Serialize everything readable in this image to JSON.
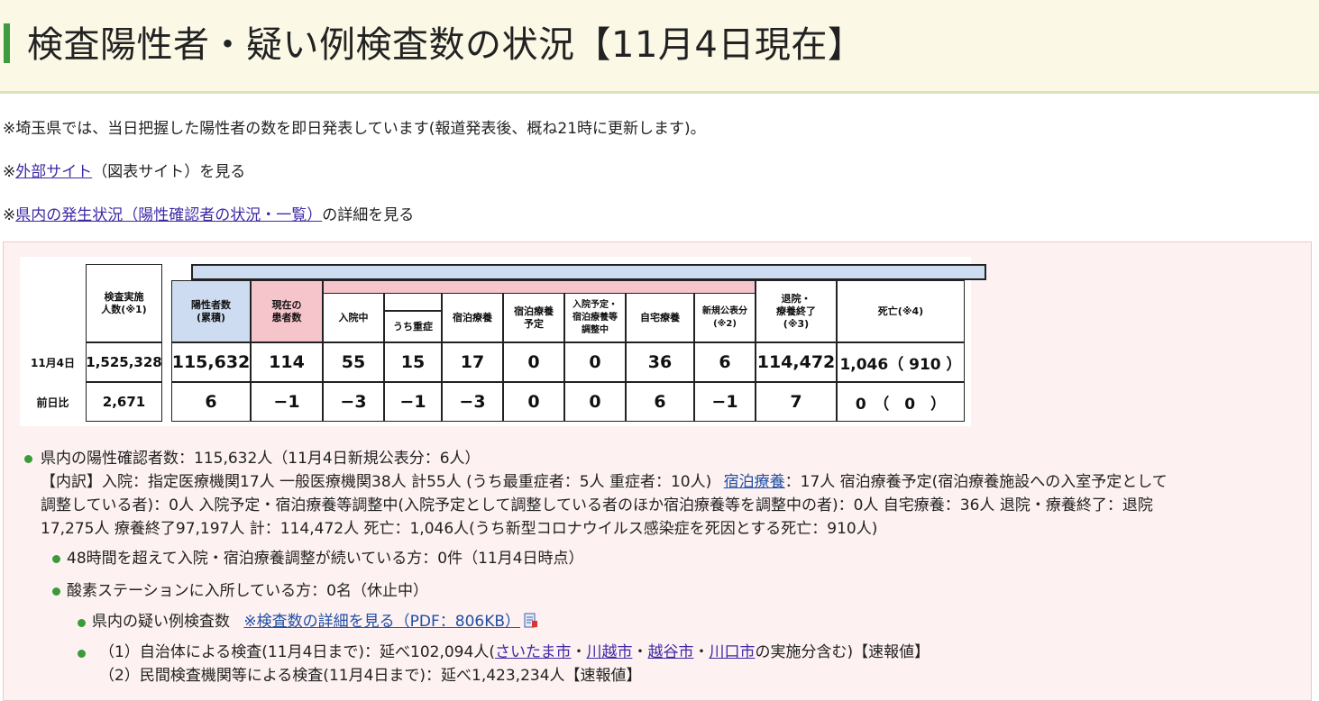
{
  "title": "検査陽性者・疑い例検査数の状況【11月4日現在】",
  "intro": {
    "line1": "※埼玉県では、当日把握した陽性者の数を即日発表しています(報道発表後、概ね21時に更新します)。",
    "line2_prefix": "※",
    "line2_link": "外部サイト",
    "line2_suffix": "（図表サイト）を見る",
    "line3_prefix": "※",
    "line3_link": "県内の発生状況（陽性確認者の状況・一覧）",
    "line3_suffix": "の詳細を見る"
  },
  "table": {
    "headers": {
      "tests": "検査実施\n人数(※1)",
      "positives": "陽性者数\n(累積)",
      "current": "現在の\n患者数",
      "hospitalized": "入院中",
      "severe": "うち重症",
      "hotel": "宿泊療養",
      "hotel_planned": "宿泊療養\n予定",
      "adjusting": "入院予定・\n宿泊療養等\n調整中",
      "home": "自宅療養",
      "new_published": "新規公表分\n(※2)",
      "recovered": "退院・\n療養終了\n(※3)",
      "deaths": "死亡(※4)"
    },
    "rows": [
      {
        "label": "11月4日",
        "tests": "1,525,328",
        "positives": "115,632",
        "current": "114",
        "hospitalized": "55",
        "severe": "15",
        "hotel": "17",
        "hotel_planned": "0",
        "adjusting": "0",
        "home": "36",
        "new_published": "6",
        "recovered": "114,472",
        "deaths": "1,046（ 910 ）"
      },
      {
        "label": "前日比",
        "tests": "2,671",
        "positives": "6",
        "current": "−1",
        "hospitalized": "−3",
        "severe": "−1",
        "hotel": "−3",
        "hotel_planned": "0",
        "adjusting": "0",
        "home": "6",
        "new_published": "−1",
        "recovered": "7",
        "deaths": "0　（　0　）"
      }
    ]
  },
  "details": {
    "summary": "県内の陽性確認者数：115,632人（11月4日新規公表分：6人）",
    "breakdown_1a": "【内訳】入院：指定医療機関17人 一般医療機関38人 計55人 (うち最重症者：5人 重症者：10人)",
    "breakdown_1_link": "宿泊療養",
    "breakdown_1b": "：17人 宿泊療養予定(宿泊療養施設への入室予定として",
    "breakdown_2": "調整している者)：0人 入院予定・宿泊療養等調整中(入院予定として調整している者のほか宿泊療養等を調整中の者)：0人 自宅療養：36人 退院・療養終了：退院",
    "breakdown_3": "17,275人 療養終了97,197人 計：114,472人 死亡：1,046人(うち新型コロナウイルス感染症を死因とする死亡：910人)",
    "waiting": "48時間を超えて入院・宿泊療養調整が続いている方：0件（11月4日時点）",
    "oxygen": "酸素ステーションに入所している方：0名（休止中）",
    "suspected_label": "県内の疑い例検査数",
    "suspected_link": "※検査数の詳細を見る（PDF：806KB）",
    "local_prefix": "（1）自治体による検査(11月4日まで)：延べ102,094人(",
    "city1": "さいたま市",
    "city2": "川越市",
    "city3": "越谷市",
    "city4": "川口市",
    "sep": "・",
    "local_suffix": "の実施分含む)【速報値】",
    "private": "（2）民間検査機関等による検査(11月4日まで)：延べ1,423,234人【速報値】"
  },
  "colors": {
    "accent_green": "#3f9b3f",
    "title_bg": "#fbf8e6",
    "panel_bg": "#fdf1f1",
    "header_pink": "#f6c4cb",
    "header_blue": "#cddcf0",
    "link": "#3f2aa6"
  }
}
